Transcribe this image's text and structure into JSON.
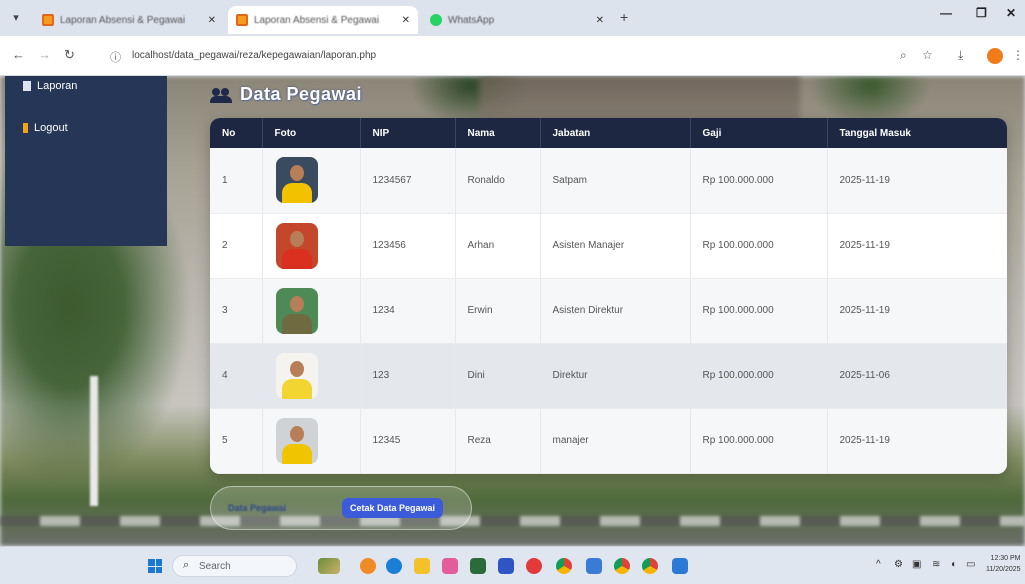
{
  "browser": {
    "tabs": [
      {
        "label": "Laporan Absensi & Pegawai",
        "active": false
      },
      {
        "label": "Laporan Absensi & Pegawai",
        "active": true
      },
      {
        "label": "WhatsApp",
        "active": false
      }
    ],
    "url": "localhost/data_pegawai/reza/kepegawaian/laporan.php"
  },
  "sidebar": {
    "items": [
      {
        "label": "Laporan",
        "icon": "document-icon"
      },
      {
        "label": "Logout",
        "icon": "door-icon"
      }
    ]
  },
  "page": {
    "title": "Data Pegawai"
  },
  "table": {
    "headers": [
      "No",
      "Foto",
      "NIP",
      "Nama",
      "Jabatan",
      "Gaji",
      "Tanggal Masuk"
    ],
    "rows": [
      {
        "no": "1",
        "nip": "1234567",
        "nama": "Ronaldo",
        "jabatan": "Satpam",
        "gaji": "Rp 100.000.000",
        "tanggal": "2025-11-19",
        "photo_bg": "#3a4a5f",
        "photo_shirt": "#f2c200"
      },
      {
        "no": "2",
        "nip": "123456",
        "nama": "Arhan",
        "jabatan": "Asisten Manajer",
        "gaji": "Rp 100.000.000",
        "tanggal": "2025-11-19",
        "photo_bg": "#c5472b",
        "photo_shirt": "#d9301f"
      },
      {
        "no": "3",
        "nip": "1234",
        "nama": "Erwin",
        "jabatan": "Asisten Direktur",
        "gaji": "Rp 100.000.000",
        "tanggal": "2025-11-19",
        "photo_bg": "#4d8a55",
        "photo_shirt": "#6f6a3f"
      },
      {
        "no": "4",
        "nip": "123",
        "nama": "Dini",
        "jabatan": "Direktur",
        "gaji": "Rp 100.000.000",
        "tanggal": "2025-11-06",
        "photo_bg": "#f5f3ef",
        "photo_shirt": "#f2d530"
      },
      {
        "no": "5",
        "nip": "12345",
        "nama": "Reza",
        "jabatan": "manajer",
        "gaji": "Rp 100.000.000",
        "tanggal": "2025-11-19",
        "photo_bg": "#cfd3d6",
        "photo_shirt": "#f0c400"
      }
    ]
  },
  "buttons": {
    "back_label": "Data Pegawai",
    "print_label": "Cetak Data Pegawai"
  },
  "taskbar": {
    "search_placeholder": "Search",
    "time": "12:30 PM",
    "date": "11/20/2025"
  },
  "colors": {
    "header": "#1d2742",
    "sidebar": "#253657",
    "print_button": "#3b5bdb"
  }
}
